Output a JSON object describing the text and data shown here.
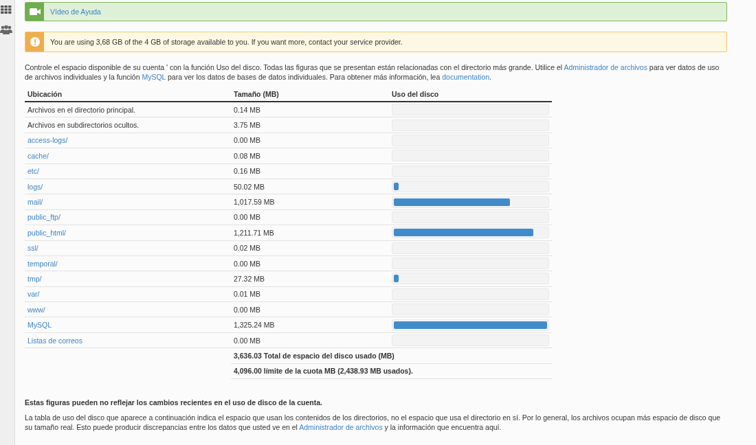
{
  "help_banner": {
    "label": "Vídeo de Ayuda"
  },
  "storage_alert": {
    "text": "You are using 3,68 GB of the 4 GB of storage available to you. If you want more, contact your service provider."
  },
  "intro": [
    {
      "kind": "text",
      "text": "Controle el espacio disponible de su cuenta ' con la función Uso del disco. Todas las figuras que se presentan están relacionadas con el directorio más grande. Utilice el "
    },
    {
      "kind": "link",
      "text": "Administrador de archivos"
    },
    {
      "kind": "text",
      "text": " para ver datos de uso de archivos individuales y la función "
    },
    {
      "kind": "link",
      "text": "MySQL"
    },
    {
      "kind": "text",
      "text": " para ver los datos de bases de datos individuales. Para obtener más información, lea "
    },
    {
      "kind": "link",
      "text": "documentation"
    },
    {
      "kind": "text",
      "text": "."
    }
  ],
  "table": {
    "columns": [
      "Ubicación",
      "Tamaño (MB)",
      "Uso del disco"
    ],
    "rows": [
      {
        "kind": "text",
        "location": "Archivos en el directorio principal.",
        "size": "0.14 MB"
      },
      {
        "kind": "text",
        "location": "Archivos en subdirectorios ocultos.",
        "size": "3.75 MB"
      },
      {
        "kind": "link",
        "location": "access-logs/",
        "size": "0.00 MB"
      },
      {
        "kind": "link",
        "location": "cache/",
        "size": "0.08 MB"
      },
      {
        "kind": "link",
        "location": "etc/",
        "size": "0.16 MB"
      },
      {
        "kind": "link",
        "location": "logs/",
        "size": "50.02 MB",
        "level": 0.03
      },
      {
        "kind": "link",
        "location": "mail/",
        "size": "1,017.59 MB",
        "level": 0.76
      },
      {
        "kind": "link",
        "location": "public_ftp/",
        "size": "0.00 MB"
      },
      {
        "kind": "link",
        "location": "public_html/",
        "size": "1,211.71 MB",
        "level": 0.91
      },
      {
        "kind": "link",
        "location": "ssl/",
        "size": "0.02 MB"
      },
      {
        "kind": "link",
        "location": "temporal/",
        "size": "0.00 MB"
      },
      {
        "kind": "link",
        "location": "tmp/",
        "size": "27.32 MB",
        "level": 0.03
      },
      {
        "kind": "link",
        "location": "var/",
        "size": "0.01 MB"
      },
      {
        "kind": "link",
        "location": "www/",
        "size": "0.00 MB"
      },
      {
        "kind": "link",
        "location": "MySQL",
        "size": "1,325.24 MB",
        "level": 1
      },
      {
        "kind": "link",
        "location": "Listas de correos",
        "size": "0.00 MB"
      }
    ],
    "totals": [
      "3,636.03 Total de espacio del disco usado (MB)",
      "4,096.00 límite de la cuota MB (2,438.93 MB usados)."
    ]
  },
  "note_title": "Estas figuras pueden no reflejar los cambios recientes en el uso de disco de la cuenta.",
  "note": [
    {
      "kind": "text",
      "text": "La tabla de uso del disco que aparece a continuación indica el espacio que usan los contenidos de los directorios, no el espacio que usa el directorio en sí. Por lo general, los archivos ocupan más espacio de disco que su tamaño real. Esto puede producir discrepancias entre los datos que usted ve en el "
    },
    {
      "kind": "link",
      "text": "Administrador de archivos"
    },
    {
      "kind": "text",
      "text": " y la información que encuentra aquí."
    }
  ]
}
